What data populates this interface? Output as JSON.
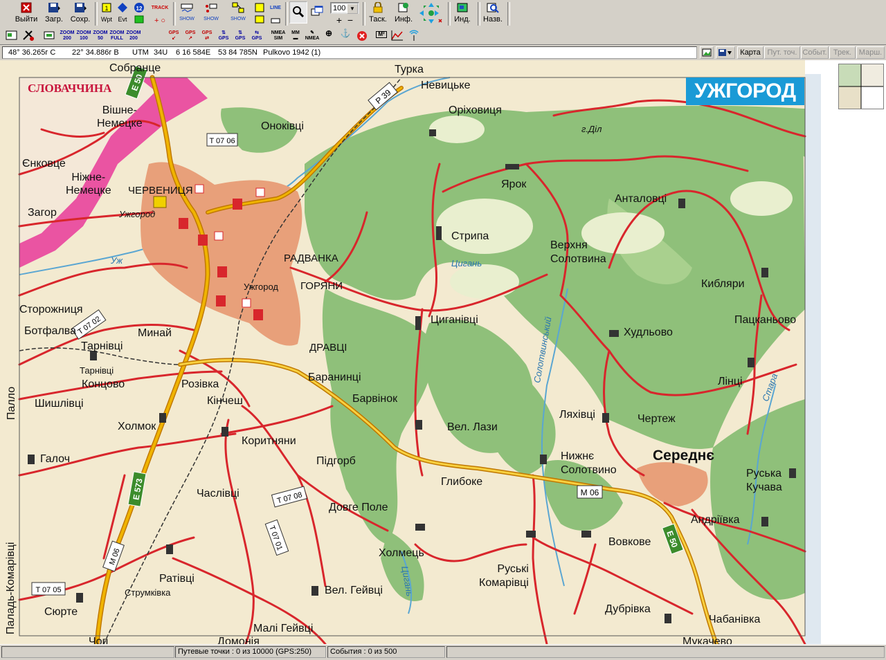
{
  "toolbar": {
    "exit": "Выйти",
    "load": "Загр.",
    "save": "Сохр.",
    "wpt": "Wpt",
    "evt": "Evt",
    "track_icon_text": "TRACK",
    "show_text": "SHOW",
    "zoom_value": "100",
    "tasks": "Таск.",
    "info": "Инф.",
    "ind": "Инд.",
    "names": "Назв.",
    "num_badge": "12",
    "line_text": "LINE"
  },
  "toolbar2": {
    "zooms": [
      {
        "top": "ZOOM",
        "bottom": "200"
      },
      {
        "top": "ZOOM",
        "bottom": "100"
      },
      {
        "top": "ZOOM",
        "bottom": "50"
      },
      {
        "top": "ZOOM",
        "bottom": "FULL"
      },
      {
        "top": "ZOOM",
        "bottom": "200"
      }
    ],
    "gps": [
      "GPS",
      "GPS",
      "GPS",
      "GPS",
      "GPS",
      "GPS"
    ],
    "nmea_sim": "NMEA SIM",
    "mm_label": "MM",
    "nmea": "NMEA",
    "m2": "M²"
  },
  "coords": {
    "lat": "48° 36.265г С",
    "lon": "22° 34.886г В",
    "utm_label": "UTM",
    "zone": "34U",
    "east": "6 16 584E",
    "north": "53 84 785N",
    "datum": "Pulkovo 1942 (1)"
  },
  "map_buttons": {
    "map": "Карта",
    "waypoints": "Пут. точ.",
    "events": "Событ.",
    "track": "Трек.",
    "route": "Марш."
  },
  "map": {
    "title": "УЖГОРОД",
    "country": "СЛОВАЧЧИНА",
    "labels": {
      "sobrance": "Собранце",
      "turka": "Турка",
      "nevytske": "Невицьке",
      "orikhovytsia": "Оріховиця",
      "vishne_nemecke": "Вішне-\nНемецке",
      "onokivtsi": "Оноківці",
      "g_dil": "г.Діл",
      "enkovtse": "Єнковце",
      "nizhne_nemecke": "Ніжне-\nНемецке",
      "chervenytsia": "ЧЕРВЕНИЦЯ",
      "yarok": "Ярок",
      "antalovtsi": "Анталовці",
      "zahor": "Загор",
      "uzhhorod_small": "Ужгород",
      "strypa": "Стрипа",
      "verkhnia_solotvyna": "Верхня\nСолотвина",
      "tsyhan": "Цигань",
      "radvanka": "РАДВАНКА",
      "uzh": "Уж",
      "horiany": "ГОРЯНИ",
      "uzhhorod_center": "Ужгород",
      "kybliary": "Кибляри",
      "storozhnytsia": "Сторожниця",
      "tsyhanivtsi": "Циганівці",
      "patskanovo": "Пацканьово",
      "botfalva": "Ботфалва",
      "minai": "Минай",
      "khudlovo": "Худльово",
      "tarnivtsi": "Тарнівці",
      "dravtsi": "ДРАВЦІ",
      "tarnivtsi2": "Тарнівці",
      "lintsi": "Лінці",
      "kontsovo": "Концово",
      "baranyntsi": "Баранинці",
      "rozivka": "Розівка",
      "pallo": "Палло",
      "shyshlivtsi": "Шишлівці",
      "kinchesh": "Кінчеш",
      "barvinok": "Барвінок",
      "stara": "Стара",
      "kholmok": "Холмок",
      "liakhivtsi": "Ляхівці",
      "chertezh": "Чертеж",
      "vel_lazy": "Вел. Лази",
      "solotvynskyi": "Солотвинський",
      "koryntniany": "Коритняни",
      "serednie": "Середнє",
      "halloch": "Галоч",
      "pidhorb": "Підгорб",
      "nyzhnie_solotvyno": "Нижнє\nСолотвино",
      "ruska_kuchava": "Руська\nКучава",
      "hlyboke": "Глибоке",
      "chaslivtsi": "Часлівці",
      "dovhe_pole": "Довге Поле",
      "andriivka": "Андріївка",
      "paladj_komarivtsi": "Паладь-Комарівці",
      "kholmets": "Холмець",
      "vovkove": "Вовкове",
      "ratyvtsi": "Ратівці",
      "ruski_komarivtsi": "Руські\nКомарівці",
      "strumkivka": "Струмківка",
      "vel_heivtsi": "Вел. Гейвці",
      "siurte": "Сюрте",
      "dubrivka": "Дубрівка",
      "chabanivka": "Чабанівка",
      "mali_heivtsi": "Малі Гейвці",
      "chop": "Чоп",
      "domonia": "Домонія",
      "mukachevo": "Мукачево"
    },
    "road_signs": [
      "E 50",
      "P 39",
      "T 07 06",
      "T 07 02",
      "E 573",
      "M 06",
      "T 07 08",
      "T 07 01",
      "M 06",
      "T 07 05",
      "E 50"
    ]
  },
  "status": {
    "waypoints": "Путевые точки : 0 из 10000  (GPS:250)",
    "events": "События : 0 из 500"
  },
  "colors": {
    "forest": "#8fc07a",
    "plain": "#f7f1dc",
    "road_red": "#d8262c",
    "road_major": "#f0b400",
    "urban": "#e8a07a",
    "slovakia": "#e83a9a",
    "river": "#5aa6d2",
    "title_bg": "#1a9ad6"
  }
}
